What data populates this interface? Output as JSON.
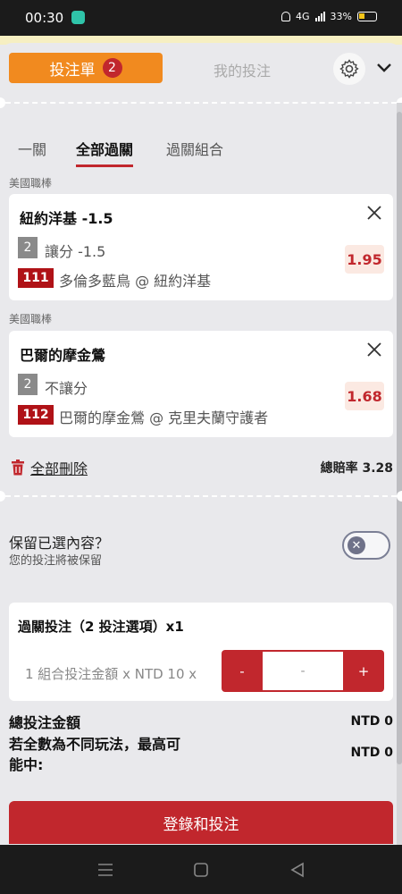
{
  "status_bar": {
    "time": "00:30",
    "battery": "33%",
    "network": "4G"
  },
  "header": {
    "betslip_tab": "投注單",
    "betslip_count": "2",
    "mybets_tab": "我的投注"
  },
  "subtabs": [
    "一關",
    "全部過關",
    "過關組合"
  ],
  "bets": [
    {
      "league": "美國職棒",
      "title": "紐約洋基 -1.5",
      "num": "2",
      "market": "讓分 -1.5",
      "event_id": "111",
      "matchup": "多倫多藍鳥 @ 紐約洋基",
      "odds": "1.95"
    },
    {
      "league": "美國職棒",
      "title": "巴爾的摩金鶯",
      "num": "2",
      "market": "不讓分",
      "event_id": "112",
      "matchup": "巴爾的摩金鶯 @ 克里夫蘭守護者",
      "odds": "1.68"
    }
  ],
  "actions": {
    "delete_all": "全部刪除",
    "total_odds_label": "總賠率",
    "total_odds_value": "3.28"
  },
  "keep": {
    "title": "保留已選內容？",
    "subtitle": "您的投注將被保留"
  },
  "parlay": {
    "title": "過關投注（2 投注選項）x1",
    "stake_label": "1 組合投注金額 x NTD 10 x",
    "minus": "-",
    "value": "-",
    "plus": "+"
  },
  "summary": {
    "total_label": "總投注金額",
    "total_value": "NTD 0",
    "max_label_line1": "若全數為不同玩法，最高可",
    "max_label_line2": "能中:",
    "max_value": "NTD 0"
  },
  "submit": "登錄和投注",
  "colors": {
    "accent": "#c1272d",
    "tab_orange": "#f18a1f",
    "odds_bg": "#fbe9e2"
  }
}
